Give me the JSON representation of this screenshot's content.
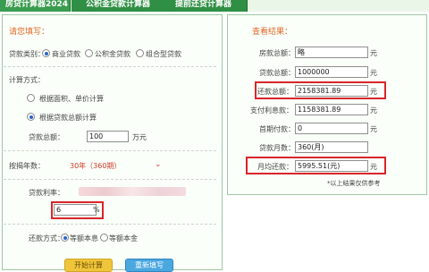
{
  "tabs": [
    {
      "label": "房贷计算器2024"
    },
    {
      "label": "公积金贷款计算器"
    },
    {
      "label": "提前还贷计算器"
    }
  ],
  "left": {
    "title": "请您填写：",
    "loan_type_label": "贷款类别：",
    "loan_type_options": [
      "商业贷款",
      "公积金贷款",
      "组合型贷款"
    ],
    "calc_method_label": "计算方式：",
    "calc_option_area": "根据面积、单价计算",
    "calc_option_total": "根据贷款总额计算",
    "loan_total_label": "贷款总额：",
    "loan_total_value": "100",
    "loan_total_unit": "万元",
    "years_label": "按揭年数：",
    "years_value": "30年（360期）",
    "rate_label": "贷款利率：",
    "rate_value": "6",
    "rate_unit": "%",
    "repay_label": "还款方式：",
    "repay_options": [
      "等额本息",
      "等额本金"
    ],
    "calc_button": "开始计算",
    "reset_button": "重新填写"
  },
  "right": {
    "title": "查看结果：",
    "rows": [
      {
        "label": "房款总额：",
        "value": "略",
        "unit": "元"
      },
      {
        "label": "贷款总额：",
        "value": "1000000",
        "unit": "元"
      },
      {
        "label": "还款总额：",
        "value": "2158381.89",
        "unit": "元"
      },
      {
        "label": "支付利息款：",
        "value": "1158381.89",
        "unit": "元"
      },
      {
        "label": "首期付款：",
        "value": "0",
        "unit": "元"
      },
      {
        "label": "贷款月数：",
        "value": "360(月)",
        "unit": ""
      },
      {
        "label": "月均还款：",
        "value": "5995.51(元)",
        "unit": "元"
      }
    ],
    "note": "*以上结果仅供参考"
  },
  "colors": {
    "tab": "#2f8f44",
    "title": "#e06a2a",
    "highlight": "#d8262a"
  }
}
